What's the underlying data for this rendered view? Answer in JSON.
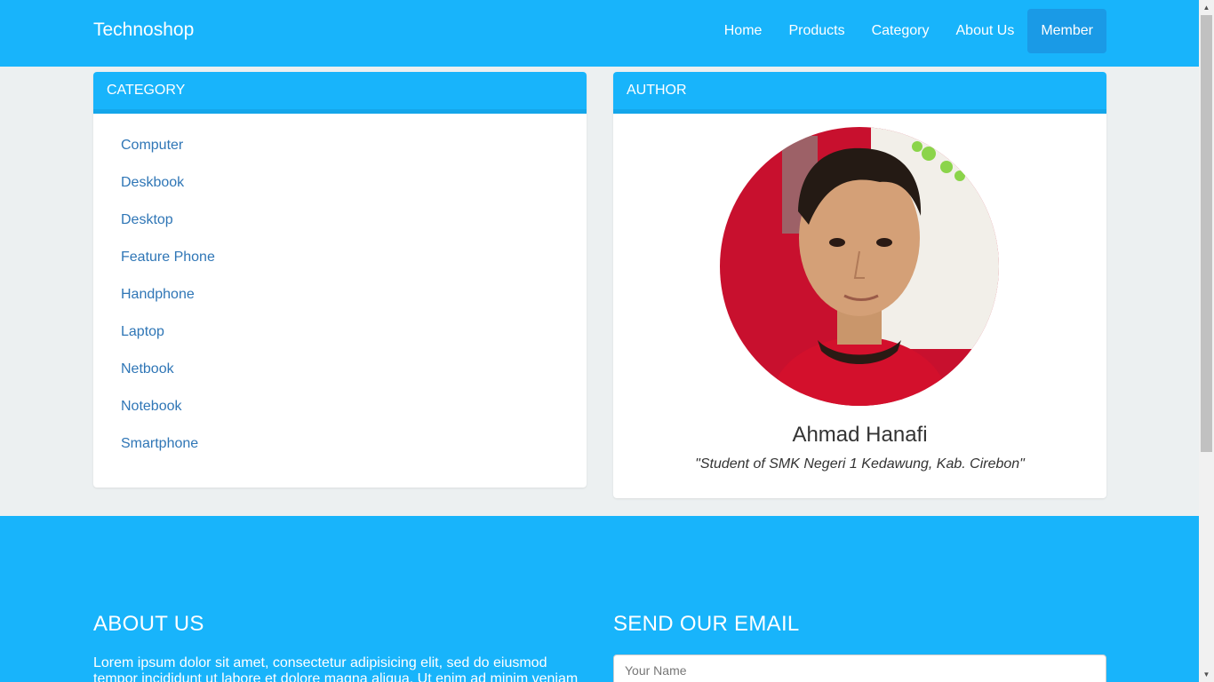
{
  "navbar": {
    "brand": "Technoshop",
    "items": [
      {
        "label": "Home"
      },
      {
        "label": "Products"
      },
      {
        "label": "Category"
      },
      {
        "label": "About Us"
      },
      {
        "label": "Member"
      }
    ]
  },
  "category_panel": {
    "title": "CATEGORY",
    "items": [
      "Computer",
      "Deskbook",
      "Desktop",
      "Feature Phone",
      "Handphone",
      "Laptop",
      "Netbook",
      "Notebook",
      "Smartphone"
    ]
  },
  "author_panel": {
    "title": "AUTHOR",
    "name": "Ahmad Hanafi",
    "quote": "\"Student of SMK Negeri 1 Kedawung, Kab. Cirebon\""
  },
  "footer": {
    "about_title": "ABOUT US",
    "about_text": "Lorem ipsum dolor sit amet, consectetur adipisicing elit, sed do eiusmod tempor incididunt ut labore et dolore magna aliqua. Ut enim ad minim veniam",
    "email_title": "SEND OUR EMAIL",
    "name_placeholder": "Your Name"
  },
  "colors": {
    "primary": "#18b4fb",
    "active_nav": "#1a9ae6",
    "link": "#2f76b6",
    "background": "#ecf0f1"
  }
}
